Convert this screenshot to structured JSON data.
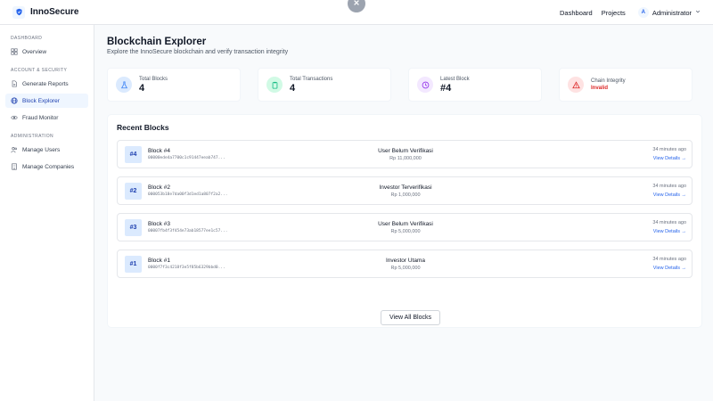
{
  "app": {
    "name": "InnoSecure"
  },
  "topnav": {
    "links": [
      "Dashboard",
      "Projects"
    ],
    "user": {
      "initial": "A",
      "name": "Administrator"
    }
  },
  "sidebar": {
    "sections": [
      {
        "title": "DASHBOARD",
        "items": [
          {
            "label": "Overview",
            "icon": "grid-icon",
            "active": false
          }
        ]
      },
      {
        "title": "ACCOUNT & SECURITY",
        "items": [
          {
            "label": "Generate Reports",
            "icon": "file-icon",
            "active": false
          },
          {
            "label": "Block Explorer",
            "icon": "globe-icon",
            "active": true
          },
          {
            "label": "Fraud Monitor",
            "icon": "eye-icon",
            "active": false
          }
        ]
      },
      {
        "title": "ADMINISTRATION",
        "items": [
          {
            "label": "Manage Users",
            "icon": "users-icon",
            "active": false
          },
          {
            "label": "Manage Companies",
            "icon": "building-icon",
            "active": false
          }
        ]
      }
    ]
  },
  "page": {
    "title": "Blockchain Explorer",
    "subtitle": "Explore the InnoSecure blockchain and verify transaction integrity"
  },
  "stats": [
    {
      "label": "Total Blocks",
      "value": "4",
      "icon": "flask-icon",
      "color": "#3b82f6",
      "bg": "#dbeafe"
    },
    {
      "label": "Total Transactions",
      "value": "4",
      "icon": "clipboard-icon",
      "color": "#10b981",
      "bg": "#d1fae5"
    },
    {
      "label": "Latest Block",
      "value": "#4",
      "icon": "clock-icon",
      "color": "#9333ea",
      "bg": "#f3e8ff"
    },
    {
      "label": "Chain Integrity",
      "value": "Invalid",
      "icon": "warning-icon",
      "color": "#dc2626",
      "bg": "#fee2e2"
    }
  ],
  "recent": {
    "title": "Recent Blocks",
    "view_all_label": "View All Blocks",
    "blocks": [
      {
        "badge": "#4",
        "name": "Block #4",
        "hash": "00000ede4a7700c1c91447eeab747...",
        "status": "User Belum Verifikasi",
        "amount": "Rp 11,000,000",
        "time": "34 minutes ago",
        "link": "View Details →"
      },
      {
        "badge": "#2",
        "name": "Block #2",
        "hash": "000053b18e7da00f3d1ed1a807f2a2...",
        "status": "Investor Terverifikasi",
        "amount": "Rp 1,000,000",
        "time": "34 minutes ago",
        "link": "View Details →"
      },
      {
        "badge": "#3",
        "name": "Block #3",
        "hash": "00007fb4f3f454e73ab18577ee1c57...",
        "status": "User Belum Verifikasi",
        "amount": "Rp 5,000,000",
        "time": "34 minutes ago",
        "link": "View Details →"
      },
      {
        "badge": "#1",
        "name": "Block #1",
        "hash": "0000f7f3c4218f3e5f85b6329bbd0...",
        "status": "Investor Utama",
        "amount": "Rp 5,000,000",
        "time": "34 minutes ago",
        "link": "View Details →"
      }
    ]
  }
}
